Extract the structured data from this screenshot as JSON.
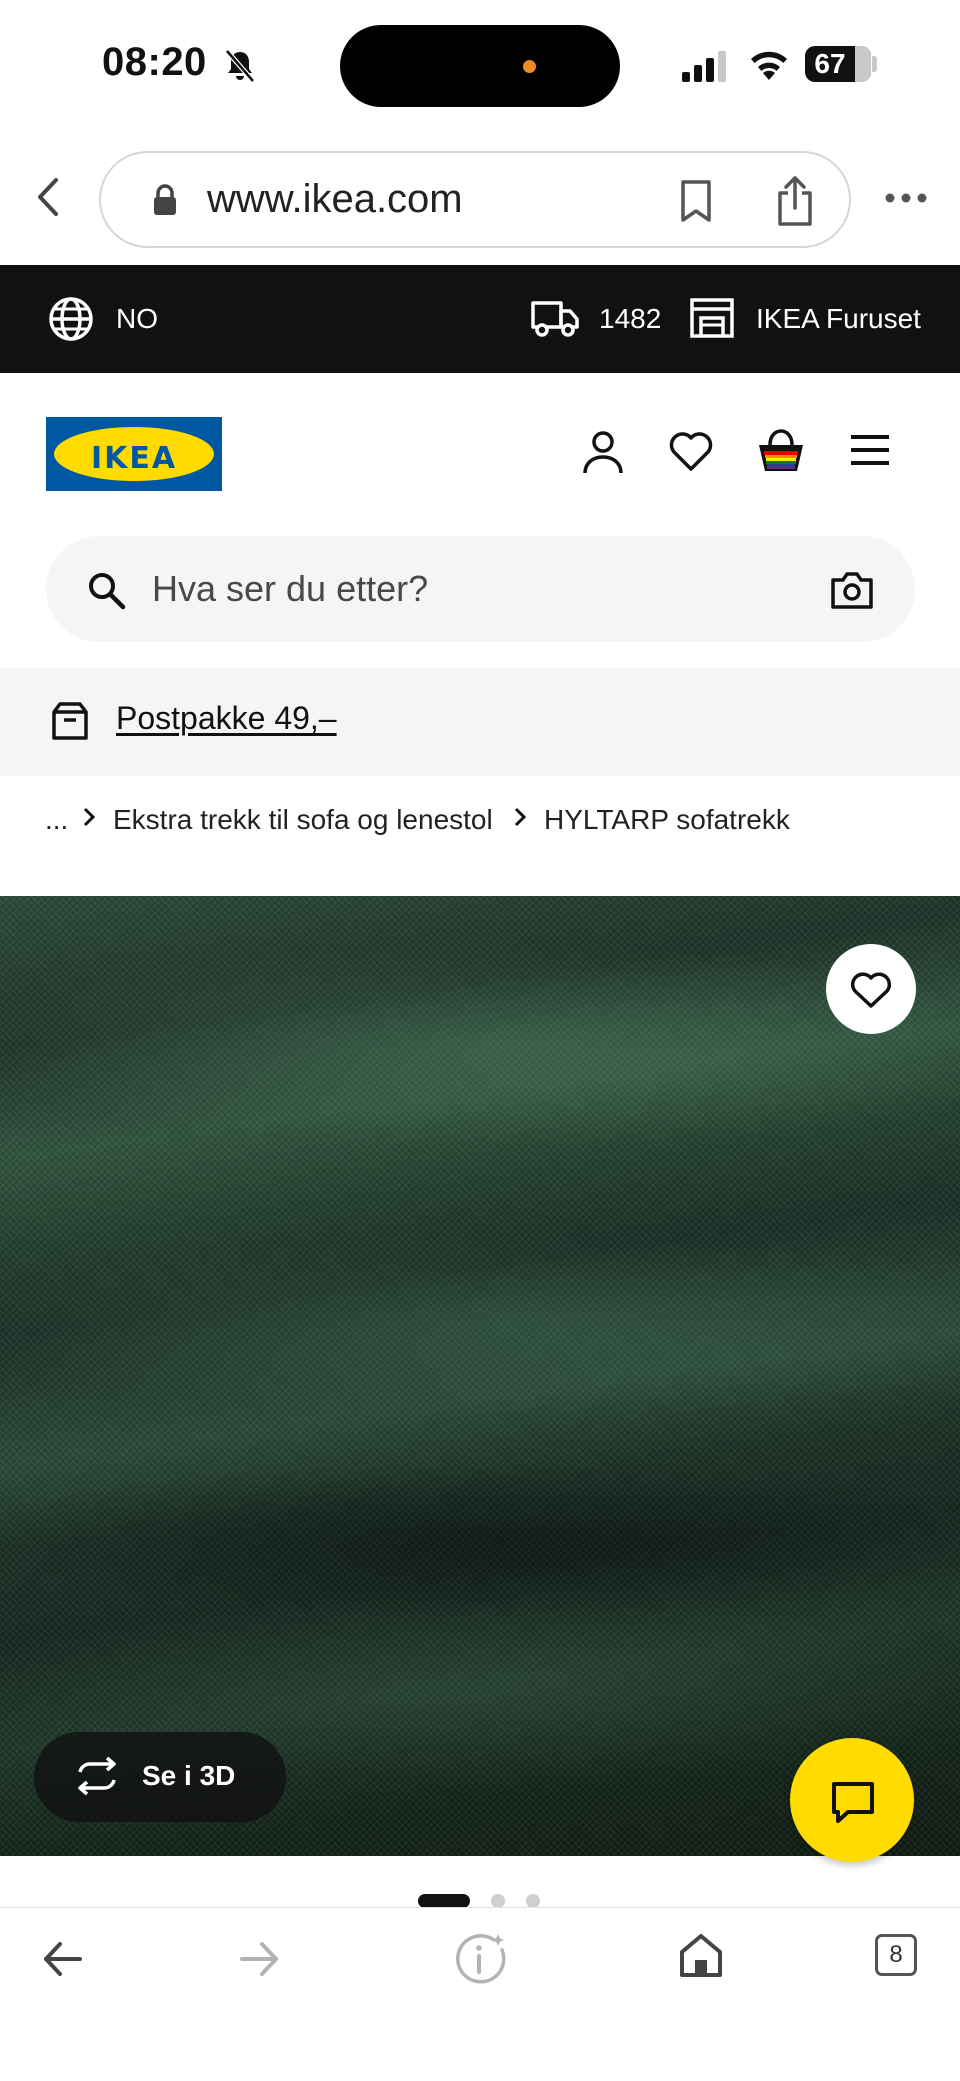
{
  "status_bar": {
    "time": "08:20",
    "battery": "67"
  },
  "browser": {
    "url": "www.ikea.com",
    "tabs_count": "8"
  },
  "top_bar": {
    "country": "NO",
    "postcode": "1482",
    "store": "IKEA Furuset"
  },
  "header": {
    "logo_text": "IKEA",
    "search_placeholder": "Hva ser du etter?"
  },
  "promo": {
    "text": "Postpakke 49,–"
  },
  "breadcrumb": [
    {
      "label": "..."
    },
    {
      "label": "Ekstra trekk til sofa og lenestol"
    },
    {
      "label": "HYLTARP sofatrekk"
    }
  ],
  "product": {
    "view_3d_label": "Se i 3D",
    "fabric_color": "#1f3a2c",
    "carousel_total": 3,
    "carousel_active": 1
  },
  "colors": {
    "ikea_blue": "#0058a3",
    "ikea_yellow": "#ffdb00",
    "topbar_bg": "#111111"
  }
}
